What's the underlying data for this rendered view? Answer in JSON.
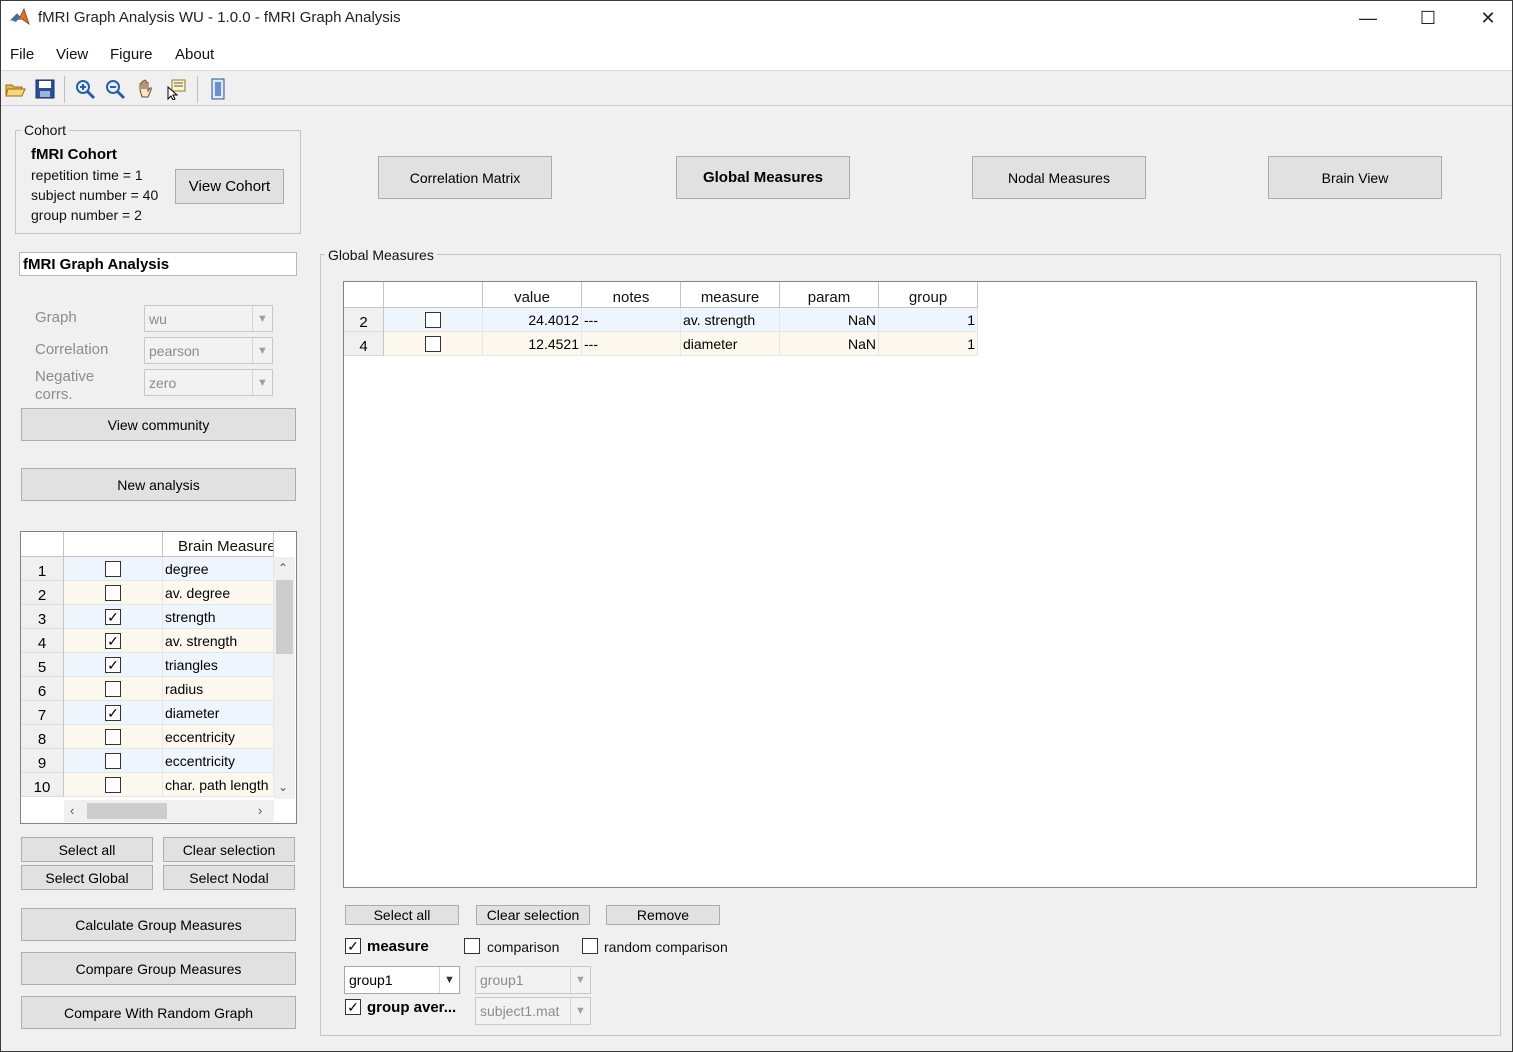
{
  "window": {
    "title": "fMRI Graph Analysis WU - 1.0.0 - fMRI Graph Analysis",
    "minimize": "—",
    "maximize": "☐",
    "close": "✕"
  },
  "menu": [
    "File",
    "View",
    "Figure",
    "About"
  ],
  "toolbar": {
    "icons": [
      "open-icon",
      "save-icon",
      "zoom-in-icon",
      "zoom-out-icon",
      "pan-icon",
      "data-cursor-icon",
      "colorbar-icon"
    ]
  },
  "cohort": {
    "panel_title": "Cohort",
    "name": "fMRI Cohort",
    "repetition": "repetition time = 1",
    "subjects": "subject number = 40",
    "groups": "group number = 2",
    "view_button": "View Cohort"
  },
  "analysis": {
    "name_value": "fMRI Graph Analysis",
    "graph_label": "Graph",
    "graph_value": "wu",
    "correlation_label": "Correlation",
    "correlation_value": "pearson",
    "negative_label_1": "Negative",
    "negative_label_2": "corrs.",
    "negative_value": "zero",
    "view_community": "View community",
    "new_analysis": "New analysis"
  },
  "measures_table": {
    "header": "Brain Measure",
    "rows": [
      {
        "n": "1",
        "checked": false,
        "name": "degree"
      },
      {
        "n": "2",
        "checked": false,
        "name": "av. degree"
      },
      {
        "n": "3",
        "checked": true,
        "name": "strength"
      },
      {
        "n": "4",
        "checked": true,
        "name": "av. strength"
      },
      {
        "n": "5",
        "checked": true,
        "name": "triangles"
      },
      {
        "n": "6",
        "checked": false,
        "name": "radius"
      },
      {
        "n": "7",
        "checked": true,
        "name": "diameter"
      },
      {
        "n": "8",
        "checked": false,
        "name": "eccentricity"
      },
      {
        "n": "9",
        "checked": false,
        "name": "eccentricity"
      },
      {
        "n": "10",
        "checked": false,
        "name": "char. path length"
      }
    ]
  },
  "left_buttons": {
    "select_all": "Select all",
    "clear_selection": "Clear selection",
    "select_global": "Select Global",
    "select_nodal": "Select Nodal",
    "calculate": "Calculate Group Measures",
    "compare": "Compare Group Measures",
    "compare_random": "Compare With Random Graph"
  },
  "tabs": {
    "correlation": "Correlation Matrix",
    "global": "Global Measures",
    "nodal": "Nodal Measures",
    "brain": "Brain View"
  },
  "global_panel": {
    "title": "Global Measures",
    "columns": [
      "value",
      "notes",
      "measure",
      "param",
      "group"
    ],
    "rows": [
      {
        "n": "2",
        "checked": false,
        "value": "24.4012",
        "notes": "---",
        "measure": "av. strength",
        "param": "NaN",
        "group": "1"
      },
      {
        "n": "4",
        "checked": false,
        "value": "12.4521",
        "notes": "---",
        "measure": "diameter",
        "param": "NaN",
        "group": "1"
      }
    ],
    "select_all": "Select all",
    "clear_selection": "Clear selection",
    "remove": "Remove",
    "measure_cb": "measure",
    "measure_checked": true,
    "comparison_cb": "comparison",
    "comparison_checked": false,
    "random_cb": "random comparison",
    "random_checked": false,
    "group_select": "group1",
    "group_select_2": "group1",
    "group_average_cb": "group aver...",
    "group_average_checked": true,
    "subject_select": "subject1.mat"
  }
}
